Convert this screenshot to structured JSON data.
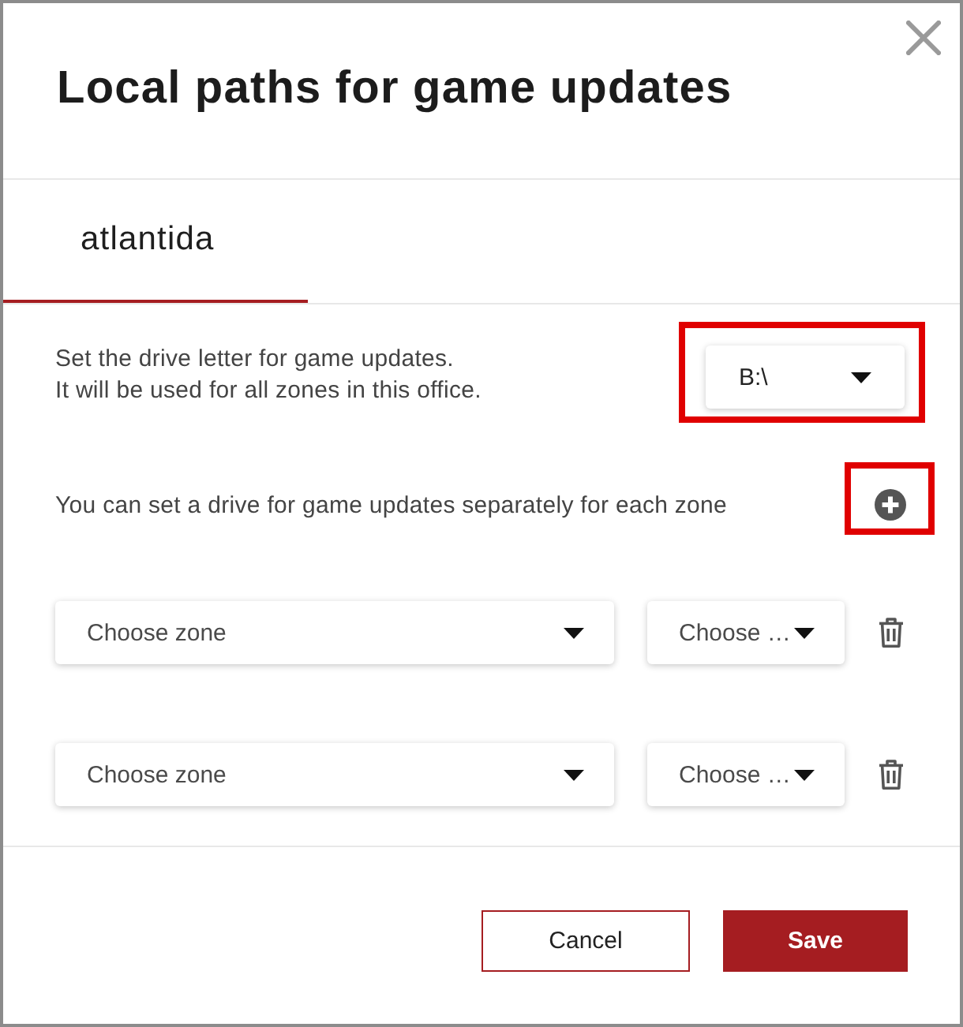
{
  "dialog": {
    "title": "Local paths for game updates"
  },
  "tabs": [
    {
      "label": "atlantida",
      "selected": true
    }
  ],
  "drive_setting": {
    "description": [
      "Set the drive letter for game updates.",
      "It will be used for all zones in this office."
    ],
    "select": {
      "value": "B:\\",
      "highlighted": true
    }
  },
  "zone_section": {
    "hint": "You can set a drive for game updates separately for each zone",
    "add_button": {
      "highlighted": true
    }
  },
  "zone_rows": [
    {
      "zone_select": {
        "placeholder": "Choose zone"
      },
      "drive_select": {
        "placeholder": "Choose …"
      }
    },
    {
      "zone_select": {
        "placeholder": "Choose zone"
      },
      "drive_select": {
        "placeholder": "Choose …"
      }
    }
  ],
  "buttons": [
    {
      "label": "Cancel",
      "kind": "secondary"
    },
    {
      "label": "Save",
      "kind": "primary"
    }
  ]
}
